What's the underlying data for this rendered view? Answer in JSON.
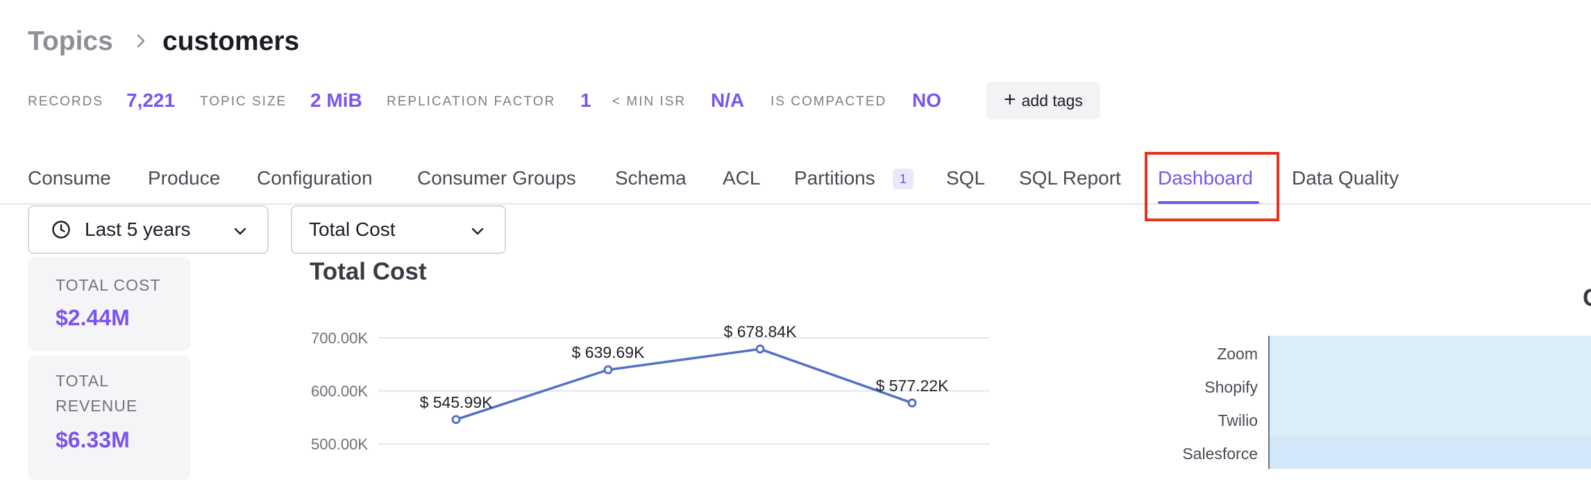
{
  "breadcrumb": {
    "parent": "Topics",
    "current": "customers"
  },
  "meta": {
    "records_label": "RECORDS",
    "records_value": "7,221",
    "size_label": "TOPIC SIZE",
    "size_value": "2 MiB",
    "replication_label": "REPLICATION FACTOR",
    "replication_value": "1",
    "min_isr_label": "< MIN ISR",
    "min_isr_value": "N/A",
    "compacted_label": "IS COMPACTED",
    "compacted_value": "NO",
    "add_tags_label": "add tags"
  },
  "tabs": [
    {
      "label": "Consume"
    },
    {
      "label": "Produce"
    },
    {
      "label": "Configuration"
    },
    {
      "label": "Consumer Groups"
    },
    {
      "label": "Schema"
    },
    {
      "label": "ACL"
    },
    {
      "label": "Partitions",
      "badge": "1"
    },
    {
      "label": "SQL"
    },
    {
      "label": "SQL Report"
    },
    {
      "label": "Dashboard",
      "active": true
    },
    {
      "label": "Data Quality"
    }
  ],
  "filters": {
    "time_range": "Last 5 years",
    "metric": "Total Cost"
  },
  "cards": [
    {
      "label": "TOTAL COST",
      "value": "$2.44M"
    },
    {
      "label_line1": "TOTAL",
      "label_line2": "REVENUE",
      "value": "$6.33M"
    }
  ],
  "chart_data": [
    {
      "type": "line",
      "title": "Total Cost",
      "values": [
        545.99,
        639.69,
        678.84,
        577.22
      ],
      "value_labels": [
        "$ 545.99K",
        "$ 639.69K",
        "$ 678.84K",
        "$ 577.22K"
      ],
      "yticks": [
        "700.00K",
        "600.00K",
        "500.00K"
      ],
      "ytick_values": [
        700,
        600,
        500
      ],
      "grid": true,
      "color": "#5470c6"
    },
    {
      "type": "bar",
      "categories": [
        "Zoom",
        "Shopify",
        "Twilio",
        "Salesforce"
      ]
    }
  ],
  "partial_title_glyph": "C",
  "colors": {
    "accent": "#7a54ee",
    "highlight": "#e8321e",
    "line": "#5470c6"
  }
}
